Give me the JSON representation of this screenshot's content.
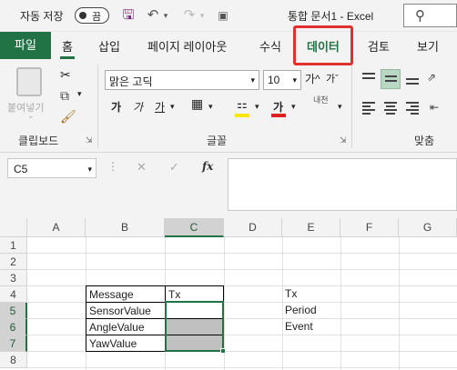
{
  "titlebar": {
    "autosave_label": "자동 저장",
    "autosave_state": "끔",
    "doc_title": "통합 문서1  -  Excel"
  },
  "tabs": {
    "file": "파일",
    "home": "홈",
    "insert": "삽입",
    "layout": "페이지 레이아웃",
    "formulas": "수식",
    "data": "데이터",
    "review": "검토",
    "view": "보기"
  },
  "ribbon": {
    "paste_label": "붙여넣기",
    "clipboard_group": "클립보드",
    "font_group": "글꼴",
    "align_group": "맞춤",
    "font_name": "맑은 고딕",
    "font_size": "10",
    "bold": "가",
    "italic": "가",
    "underline": "가",
    "font_color": "가",
    "phonetic": "내천",
    "grow": "가^",
    "shrink": "가ˇ"
  },
  "formula_bar": {
    "name_box": "C5",
    "fx": "fx",
    "value": ""
  },
  "grid": {
    "columns": [
      "A",
      "B",
      "C",
      "D",
      "E",
      "F",
      "G"
    ],
    "rows": [
      "1",
      "2",
      "3",
      "4",
      "5",
      "6",
      "7",
      "8"
    ],
    "cells": {
      "B4": "Message",
      "C4": "Tx",
      "B5": "SensorValue",
      "B6": "AngleValue",
      "B7": "YawValue",
      "E4": "Tx",
      "E5": "Period",
      "E6": "Event"
    }
  },
  "colors": {
    "excel_green": "#217346",
    "highlight_red": "#e03030",
    "shaded_cell": "#c0c0c0"
  }
}
